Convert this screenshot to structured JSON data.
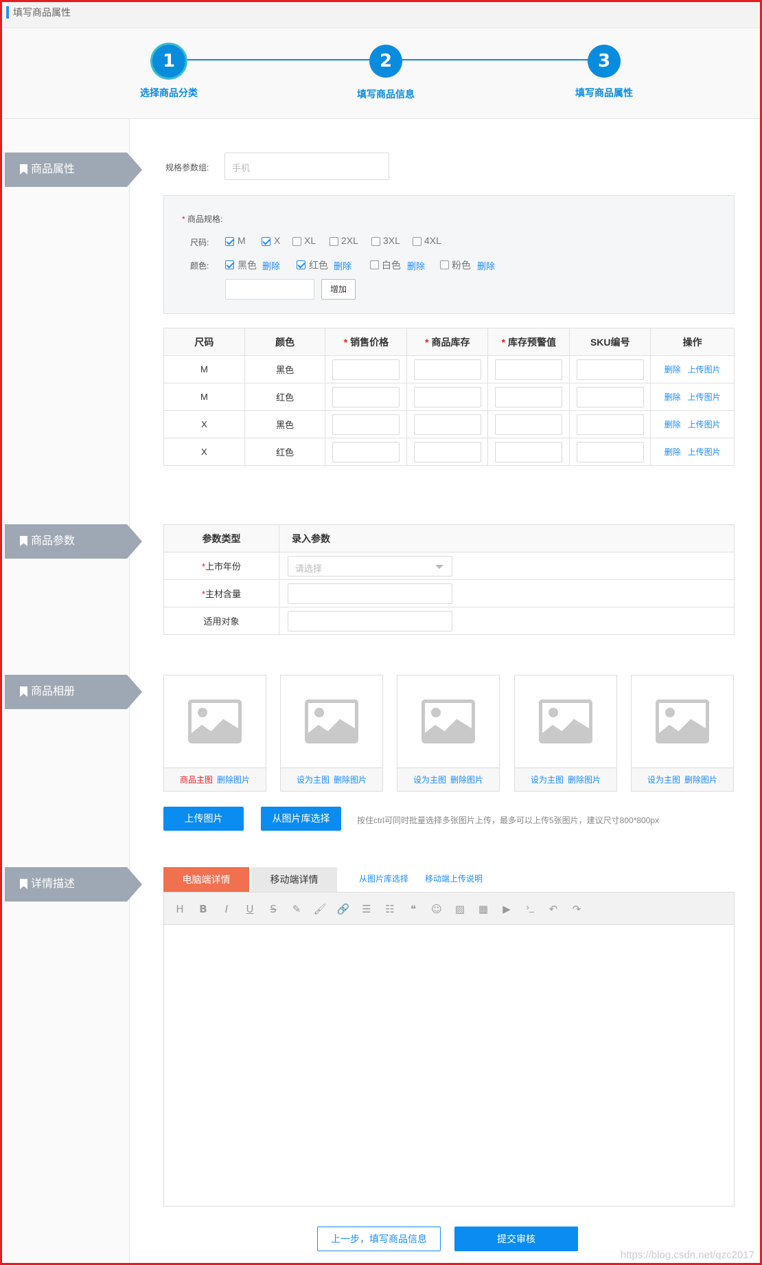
{
  "header": {
    "title": "填写商品属性"
  },
  "steps": [
    {
      "num": "1",
      "label": "选择商品分类"
    },
    {
      "num": "2",
      "label": "填写商品信息"
    },
    {
      "num": "3",
      "label": "填写商品属性"
    }
  ],
  "sections": {
    "attributes": "商品属性",
    "params": "商品参数",
    "album": "商品相册",
    "detail": "详情描述"
  },
  "spec_group": {
    "label": "规格参数组:",
    "placeholder": "手机"
  },
  "spec_box": {
    "title": "商品规格:",
    "size_label": "尺码:",
    "color_label": "颜色:",
    "sizes": [
      {
        "label": "M",
        "checked": true
      },
      {
        "label": "X",
        "checked": true
      },
      {
        "label": "XL",
        "checked": false
      },
      {
        "label": "2XL",
        "checked": false
      },
      {
        "label": "3XL",
        "checked": false
      },
      {
        "label": "4XL",
        "checked": false
      }
    ],
    "colors": [
      {
        "label": "黑色",
        "checked": true
      },
      {
        "label": "红色",
        "checked": true
      },
      {
        "label": "白色",
        "checked": false
      },
      {
        "label": "粉色",
        "checked": false
      }
    ],
    "delete_label": "删除",
    "add_button": "增加"
  },
  "sku_table": {
    "headers": [
      "尺码",
      "颜色",
      "销售价格",
      "商品库存",
      "库存预警值",
      "SKU编号",
      "操作"
    ],
    "rows": [
      {
        "size": "M",
        "color": "黑色"
      },
      {
        "size": "M",
        "color": "红色"
      },
      {
        "size": "X",
        "color": "黑色"
      },
      {
        "size": "X",
        "color": "红色"
      }
    ],
    "op_delete": "删除",
    "op_upload": "上传图片"
  },
  "param_table": {
    "headers": [
      "参数类型",
      "录入参数"
    ],
    "rows": [
      {
        "name": "上市年份",
        "required": true,
        "type": "select",
        "placeholder": "请选择"
      },
      {
        "name": "主材含量",
        "required": true,
        "type": "input"
      },
      {
        "name": "适用对象",
        "required": false,
        "type": "input"
      }
    ]
  },
  "album": {
    "photos": [
      {
        "primary": "商品主图",
        "delete": "删除图片",
        "is_main": true
      },
      {
        "primary": "设为主图",
        "delete": "删除图片",
        "is_main": false
      },
      {
        "primary": "设为主图",
        "delete": "删除图片",
        "is_main": false
      },
      {
        "primary": "设为主图",
        "delete": "删除图片",
        "is_main": false
      },
      {
        "primary": "设为主图",
        "delete": "删除图片",
        "is_main": false
      }
    ],
    "upload_button": "上传图片",
    "library_button": "从图片库选择",
    "hint": "按住ctrl可同时批量选择多张图片上传，最多可以上传5张图片，建议尺寸800*800px"
  },
  "detail": {
    "tab_pc": "电脑端详情",
    "tab_mobile": "移动端详情",
    "link_library": "从图片库选择",
    "link_mobile_help": "移动端上传说明",
    "toolbar": [
      "H",
      "B",
      "I",
      "U",
      "S",
      "✎",
      "🖌",
      "🔗",
      "☰",
      "☷",
      "❝",
      "☺",
      "▨",
      "▦",
      "▶",
      "›_",
      "↶",
      "↷"
    ]
  },
  "footer": {
    "prev_button": "上一步，填写商品信息",
    "submit_button": "提交审核"
  },
  "watermark": "https://blog.csdn.net/qzc2017",
  "colors": {
    "accent": "#1a8cff",
    "step": "#0a8cde",
    "section": "#9ea7b4",
    "tab_active": "#f07050",
    "frame": "#e51c23"
  }
}
